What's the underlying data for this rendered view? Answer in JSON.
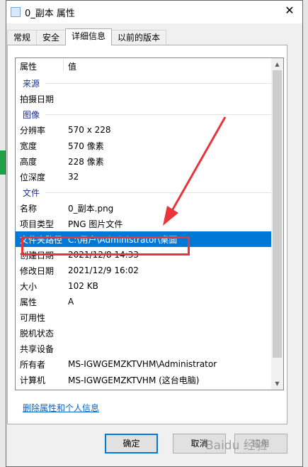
{
  "window": {
    "title": "0_副本 属性",
    "close_glyph": "✕"
  },
  "tabs": [
    {
      "label": "常规"
    },
    {
      "label": "安全"
    },
    {
      "label": "详细信息"
    },
    {
      "label": "以前的版本"
    }
  ],
  "list": {
    "header": {
      "property": "属性",
      "value": "值"
    },
    "groups": {
      "source": "来源",
      "image": "图像",
      "file": "文件"
    },
    "source_rows": [
      {
        "prop": "拍摄日期",
        "value": ""
      }
    ],
    "image_rows": [
      {
        "prop": "分辨率",
        "value": "570 x 228"
      },
      {
        "prop": "宽度",
        "value": "570 像素"
      },
      {
        "prop": "高度",
        "value": "228 像素"
      },
      {
        "prop": "位深度",
        "value": "32"
      }
    ],
    "file_rows": [
      {
        "prop": "名称",
        "value": "0_副本.png"
      },
      {
        "prop": "项目类型",
        "value": "PNG 图片文件"
      },
      {
        "prop": "文件夹路径",
        "value": "C:\\用户\\Administrator\\桌面"
      },
      {
        "prop": "创建日期",
        "value": "2021/12/8 14:33"
      },
      {
        "prop": "修改日期",
        "value": "2021/12/9 16:02"
      },
      {
        "prop": "大小",
        "value": "102 KB"
      },
      {
        "prop": "属性",
        "value": "A"
      },
      {
        "prop": "可用性",
        "value": ""
      },
      {
        "prop": "脱机状态",
        "value": ""
      },
      {
        "prop": "共享设备",
        "value": ""
      },
      {
        "prop": "所有者",
        "value": "MS-IGWGEMZKTVHM\\Administrator"
      },
      {
        "prop": "计算机",
        "value": "MS-IGWGEMZKTVHM (这台电脑)"
      }
    ]
  },
  "link": {
    "label": "删除属性和个人信息"
  },
  "buttons": {
    "ok": "确定",
    "cancel": "取消",
    "apply": "应用"
  },
  "watermark": "Baidu 经验",
  "colors": {
    "selection": "#0078d7",
    "annotation": "#e8343a",
    "group_label": "#1e3287"
  }
}
